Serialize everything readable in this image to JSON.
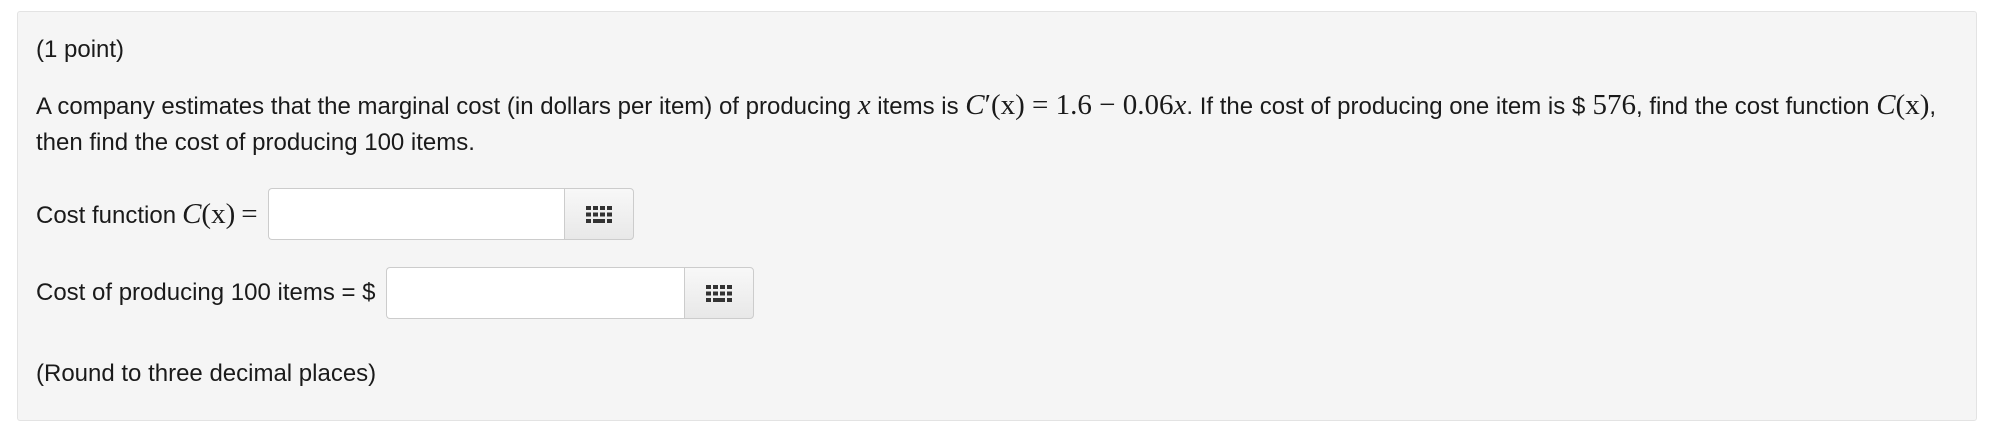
{
  "problem": {
    "points": "(1 point)",
    "statement": {
      "part1": "A company estimates that the marginal cost (in dollars per item) of producing ",
      "var_x": "x",
      "part2": " items is ",
      "derivative_func": "C",
      "derivative_prime": "′",
      "derivative_arg": "(x)",
      "derivative_eq": " = 1.6 − 0.06",
      "derivative_x": "x",
      "part3": ". If the cost of producing one item is ",
      "dollar": "$",
      "one_item_cost": " 576",
      "part4": ", find the cost function ",
      "cost_func": "C",
      "cost_arg": "(x)",
      "part5": ", then find the cost of producing 100 items."
    },
    "answer1": {
      "label_text": "Cost function",
      "label_func": "C",
      "label_arg": "(x)",
      "label_eq": "=",
      "value": "",
      "placeholder": ""
    },
    "answer2": {
      "label_text": "Cost of producing 100 items = $",
      "value": "",
      "placeholder": ""
    },
    "hint": "(Round to three decimal places)"
  },
  "icons": {
    "equation_editor": "grid-icon"
  },
  "colors": {
    "panel_background": "#f5f5f5",
    "panel_border": "#e3e3e3",
    "text": "#1a1a1a",
    "icon": "#333333"
  }
}
